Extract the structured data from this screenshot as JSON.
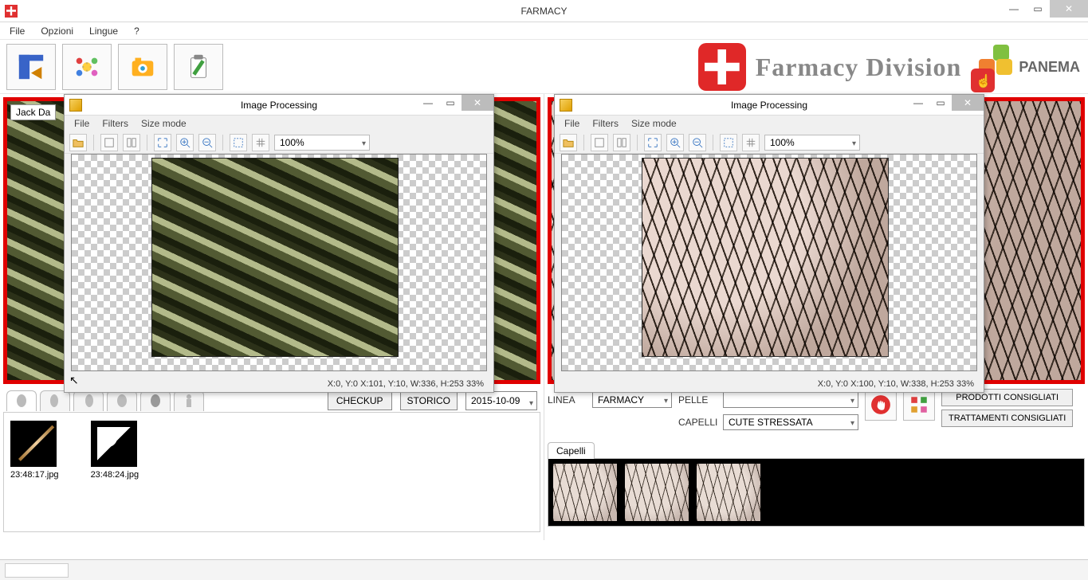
{
  "window": {
    "title": "FARMACY"
  },
  "menu": {
    "file": "File",
    "opzioni": "Opzioni",
    "lingue": "Lingue",
    "help": "?"
  },
  "branding": {
    "division": "Farmacy Division",
    "vendor": "PANEMA"
  },
  "left": {
    "patient_name": "Jack Da",
    "checkup_btn": "CHECKUP",
    "storico_btn": "STORICO",
    "date": "2015-10-09",
    "thumbs": [
      {
        "caption": "23:48:17.jpg"
      },
      {
        "caption": "23:48:24.jpg"
      }
    ]
  },
  "right": {
    "linea_label": "LINEA",
    "linea_value": "FARMACY",
    "pelle_label": "PELLE",
    "pelle_value": "",
    "capelli_label": "CAPELLI",
    "capelli_value": "CUTE STRESSATA",
    "prodotti_btn": "PRODOTTI CONSIGLIATI",
    "trattamenti_btn": "TRATTAMENTI CONSIGLIATI",
    "tab_label": "Capelli"
  },
  "imgproc": {
    "title": "Image Processing",
    "menu": {
      "file": "File",
      "filters": "Filters",
      "sizemode": "Size mode"
    },
    "zoom": "100%",
    "left_status": "X:0, Y:0  X:101, Y:10, W:336, H:253  33%",
    "right_status": "X:0, Y:0  X:100, Y:10, W:338, H:253  33%"
  }
}
